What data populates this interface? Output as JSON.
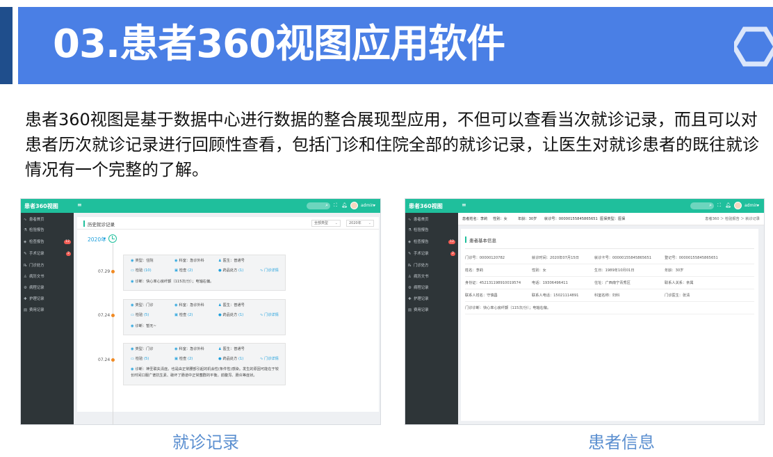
{
  "slide": {
    "title": "03.患者360视图应用软件",
    "intro": "患者360视图是基于数据中心进行数据的整合展现型应用，不但可以查看当次就诊记录，而且可以对患者历次就诊记录进行回顾性查看，包括门诊和住院全部的就诊记录，让医生对就诊患者的既往就诊情况有一个完整的了解。",
    "accent_color": "#4a7fe5",
    "caption_color": "#5b8fd0"
  },
  "app": {
    "title": "患者360视图",
    "user": "admin",
    "topbar_color": "#1fbf9c",
    "sidebar": [
      {
        "label": "患者首页",
        "icon": "pulse-icon",
        "badge": ""
      },
      {
        "label": "检验报告",
        "icon": "flask-icon",
        "badge": ""
      },
      {
        "label": "检查报告",
        "icon": "diamond-icon",
        "badge": "12"
      },
      {
        "label": "手术记录",
        "icon": "scalpel-icon",
        "badge": "2"
      },
      {
        "label": "门诊处方",
        "icon": "prescription-icon",
        "badge": ""
      },
      {
        "label": "病历文书",
        "icon": "document-icon",
        "badge": ""
      },
      {
        "label": "病程记录",
        "icon": "gear-icon",
        "badge": ""
      },
      {
        "label": "护理记录",
        "icon": "nursing-icon",
        "badge": ""
      },
      {
        "label": "费用记录",
        "icon": "receipt-icon",
        "badge": ""
      }
    ]
  },
  "visits": {
    "caption": "就诊记录",
    "panel_title": "历史就诊记录",
    "filter_type": "全部类型",
    "filter_year": "2020年",
    "year_label": "2020年",
    "entries": [
      {
        "date": "07.29",
        "type": "类型：住院",
        "dept": "科室：急诊外科",
        "doctor": "医生：普通号",
        "lab": "检验",
        "lab_count": "(10)",
        "exam": "检查",
        "exam_count": "(2)",
        "rx": "药品处方",
        "rx_count": "(1)",
        "detail": "门诊详情",
        "diagnosis": "诊断：快心率心房纤颤（115次/分）；电轴右偏。"
      },
      {
        "date": "07.24",
        "type": "类型：门诊",
        "dept": "科室：急诊外科",
        "doctor": "医生：普通号",
        "lab": "检验",
        "lab_count": "(5)",
        "exam": "检查",
        "exam_count": "(2)",
        "rx": "药品处方",
        "rx_count": "(1)",
        "detail": "门诊详情",
        "diagnosis": "诊断：暂无~"
      },
      {
        "date": "07.24",
        "type": "类型：门诊",
        "dept": "科室：急诊外科",
        "doctor": "医生：普通号",
        "lab": "检验",
        "lab_count": "(5)",
        "exam": "检查",
        "exam_count": "(2)",
        "rx": "药品处方",
        "rx_count": "(1)",
        "detail": "门诊详情",
        "diagnosis": "诊断：神圣联失清症。也是由正常腰部引起的机会性(条件性)感染。发生的原因可能在于较长时间口服广谱抗生素、破坏了肠道中正常菌群的平衡。前腹泻、肠炎等症状。"
      }
    ]
  },
  "patient": {
    "caption": "患者信息",
    "header": {
      "name": "患者姓名：李莉",
      "sex": "性别：女",
      "age": "年龄：30岁",
      "card": "就诊号：00000155845865651",
      "type": "医保类型：医保"
    },
    "breadcrumb": "患者360 ＞ 检验报告 ＞ 就诊记录",
    "section_title": "患者基本信息",
    "rows": [
      [
        "门诊号：00000120782",
        "就诊时间：2020年07月15日",
        "就诊卡号：00000155845865651",
        "登记号：00000155845865651"
      ],
      [
        "姓名：李莉",
        "性别：女",
        "生日：1989年10月01日",
        "年龄：30岁"
      ],
      [
        "身份证：452131198910019574",
        "电话：19306496411",
        "住址：广西南宁青秀区",
        "联系人关系：亲属"
      ],
      [
        "联系人姓名：守慎昌",
        "联系人电话：15021114891",
        "科室名称：妇科",
        "门诊医生：张清"
      ],
      [
        "门诊诊断：快心率心房纤颤（115次/分）；电轴右偏。",
        "",
        "",
        ""
      ]
    ]
  }
}
